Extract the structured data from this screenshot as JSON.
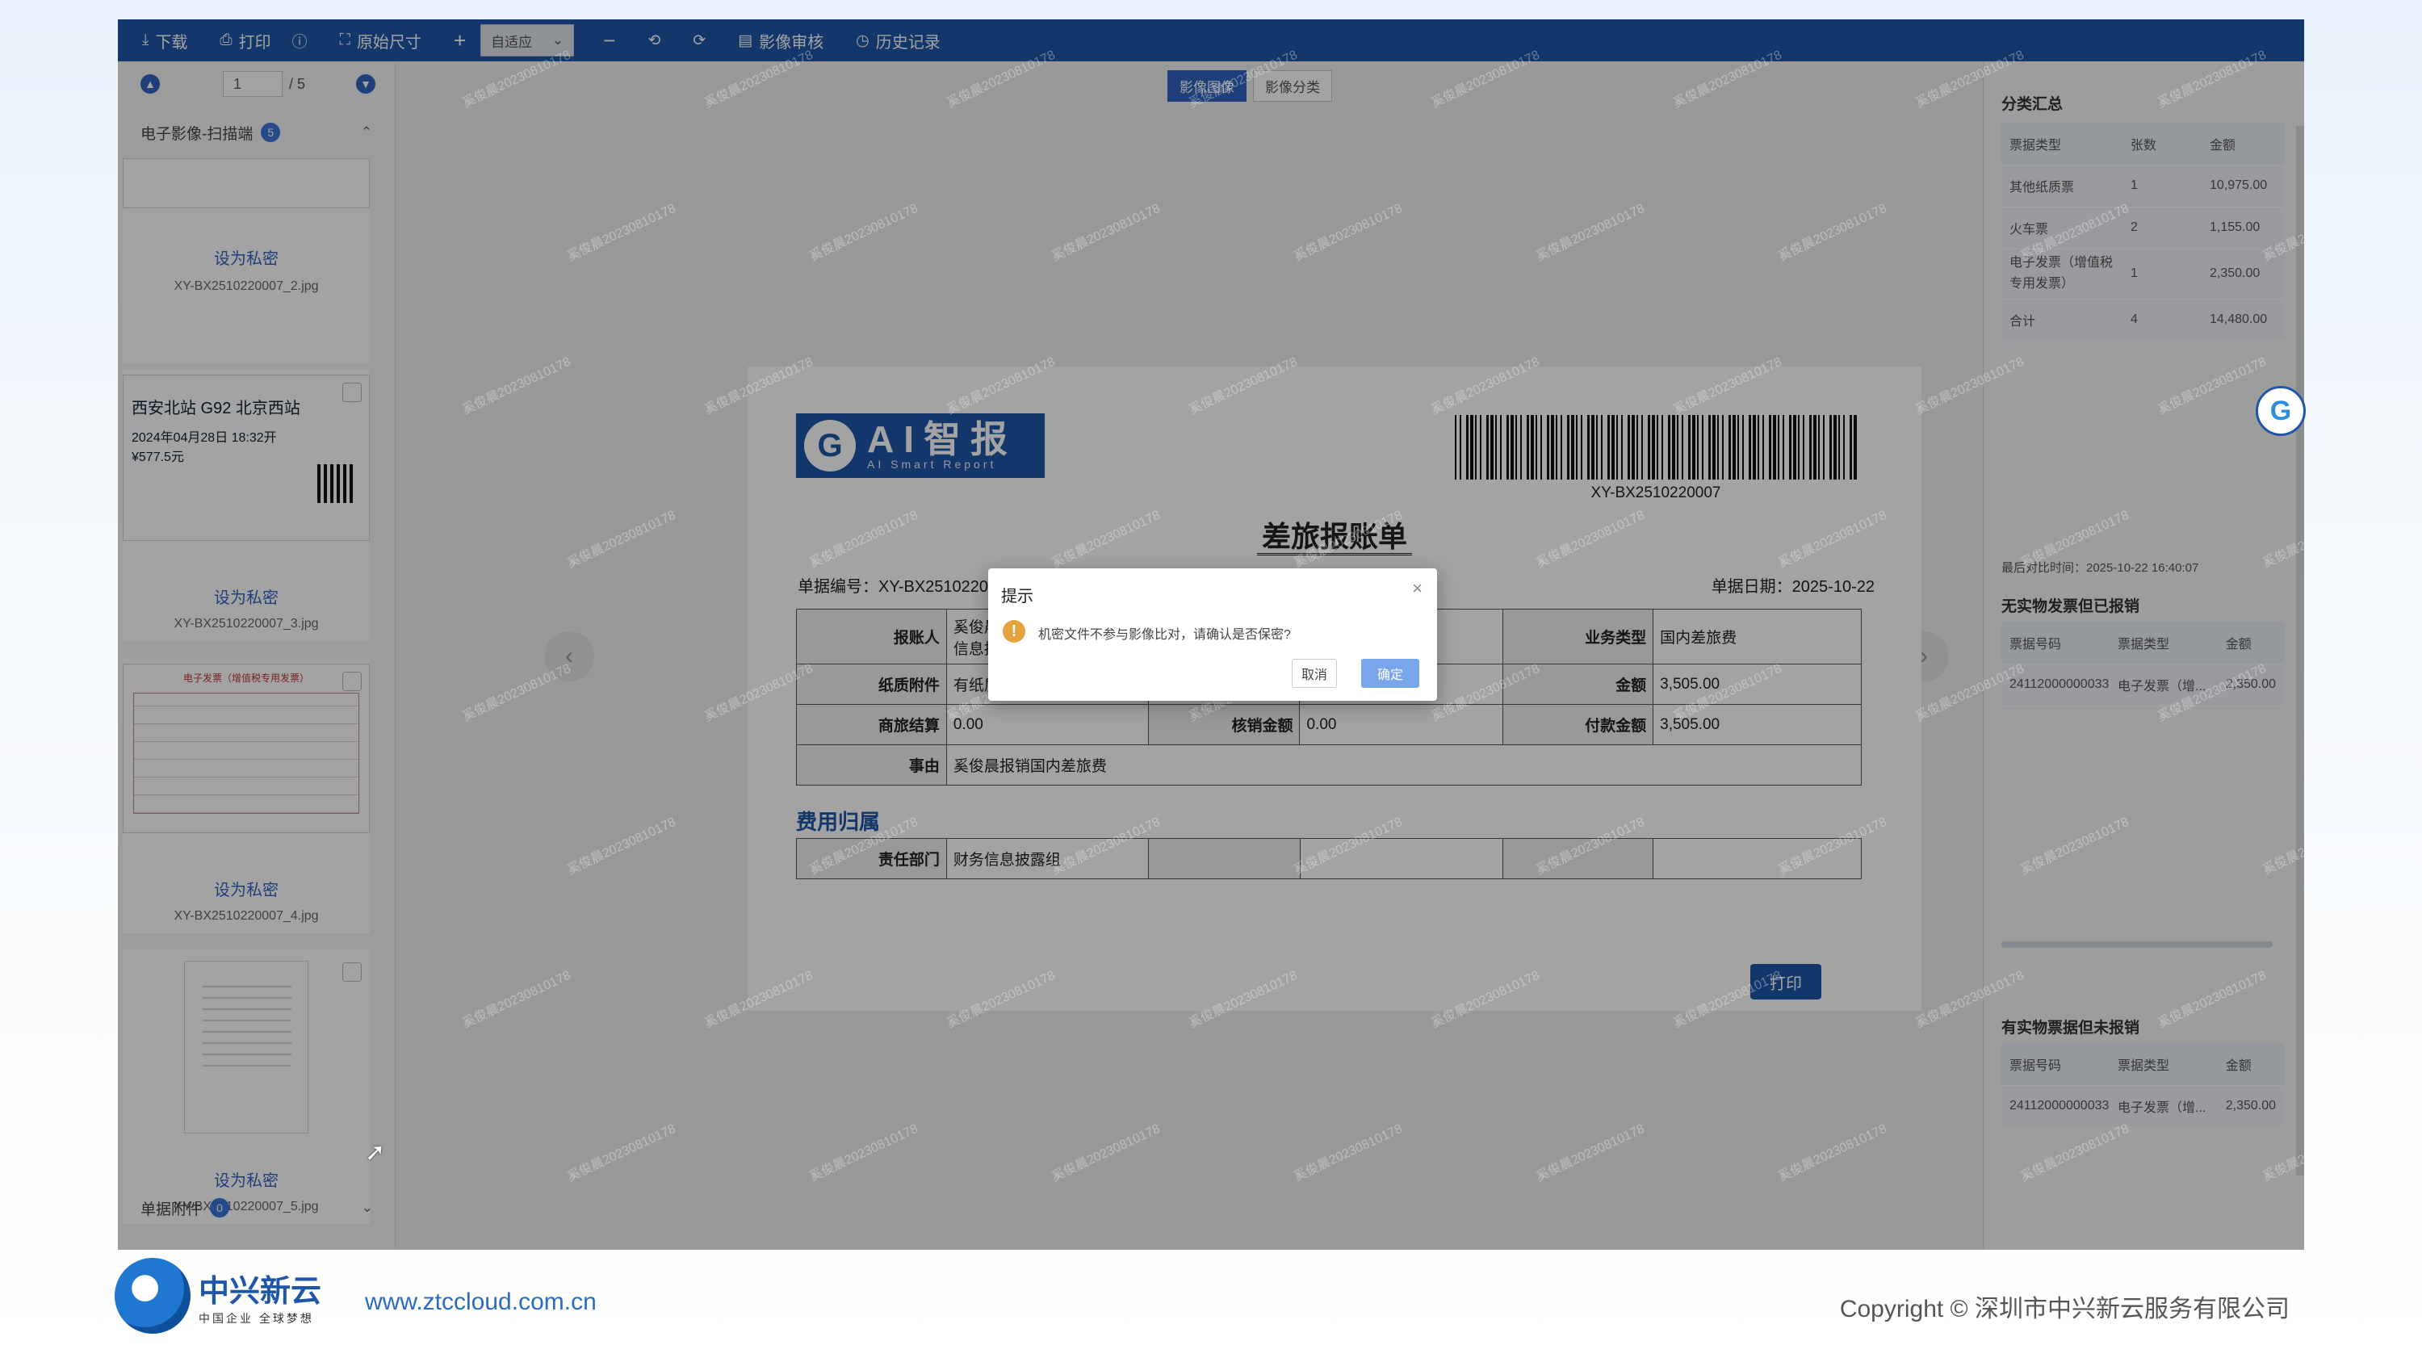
{
  "toolbar": {
    "download": "下载",
    "print": "打印",
    "original_size": "原始尺寸",
    "zoom_value": "自适应",
    "review": "影像审核",
    "history": "历史记录"
  },
  "pager": {
    "current": "1",
    "total": "/ 5"
  },
  "left": {
    "group_title": "电子影像-扫描端",
    "group_count": "5",
    "attach_title": "单据附件",
    "attach_count": "0",
    "thumbs": [
      {
        "priv": "设为私密",
        "fname": "XY-BX2510220007_2.jpg"
      },
      {
        "priv": "设为私密",
        "fname": "XY-BX2510220007_3.jpg",
        "ticket_text": "西安北站  G92  北京西站",
        "ticket_date": "2024年04月28日 18:32开",
        "ticket_price": "¥577.5元"
      },
      {
        "priv": "设为私密",
        "fname": "XY-BX2510220007_4.jpg",
        "inv_title": "电子发票（增值税专用发票）"
      },
      {
        "priv": "设为私密",
        "fname": "XY-BX2510220007_5.jpg"
      }
    ]
  },
  "center": {
    "tabs": [
      "影像图像",
      "影像分类"
    ],
    "doc": {
      "logo_big": "AI智报",
      "logo_small": "AI Smart Report",
      "barcode_num": "XY-BX2510220007",
      "title": "差旅报账单",
      "doc_no": "单据编号：XY-BX2510220007",
      "doc_date": "单据日期：2025-10-22",
      "rows": {
        "reporter_lbl": "报账人",
        "reporter_val": "奚俊晨/审核会计-财芯-财务信息披露组",
        "biz_lbl": "业务类型",
        "biz_val": "国内差旅费",
        "paper_lbl": "纸质附件",
        "paper_val": "有纸质附件",
        "amount_lbl": "金额",
        "amount_val": "3,505.00",
        "travel_lbl": "商旅结算",
        "travel_val": "0.00",
        "write_lbl": "核销金额",
        "write_val": "0.00",
        "pay_lbl": "付款金额",
        "pay_val": "3,505.00",
        "reason_lbl": "事由",
        "reason_val": "奚俊晨报销国内差旅费"
      },
      "section": "费用归属",
      "dept_lbl": "责任部门",
      "dept_val": "财务信息披露组",
      "print_btn": "打印"
    }
  },
  "right": {
    "summary_title": "分类汇总",
    "summary_headers": [
      "票据类型",
      "张数",
      "金额"
    ],
    "summary_rows": [
      {
        "type": "其他纸质票",
        "count": "1",
        "amount": "10,975.00"
      },
      {
        "type": "火车票",
        "count": "2",
        "amount": "1,155.00"
      },
      {
        "type": "电子发票（增值税专用发票）",
        "count": "1",
        "amount": "2,350.00"
      },
      {
        "type": "合计",
        "count": "4",
        "amount": "14,480.00"
      }
    ],
    "last_compare": "最后对比时间：2025-10-22 16:40:07",
    "no_physical_title": "无实物发票但已报销",
    "list_headers": [
      "票据号码",
      "票据类型",
      "金额"
    ],
    "no_physical_rows": [
      {
        "no": "24112000000033",
        "type": "电子发票（增...",
        "amount": "2,350.00"
      }
    ],
    "has_physical_title": "有实物票据但未报销",
    "has_physical_rows": [
      {
        "no": "24112000000033",
        "type": "电子发票（增...",
        "amount": "2,350.00"
      }
    ]
  },
  "modal": {
    "title": "提示",
    "message": "机密文件不参与影像比对，请确认是否保密?",
    "cancel": "取消",
    "ok": "确定"
  },
  "watermark": "奚俊晨20230810178",
  "footer": {
    "brand": "中兴新云",
    "slogan": "中国企业 全球梦想",
    "url": "www.ztccloud.com.cn",
    "copyright": "Copyright © 深圳市中兴新云服务有限公司"
  }
}
